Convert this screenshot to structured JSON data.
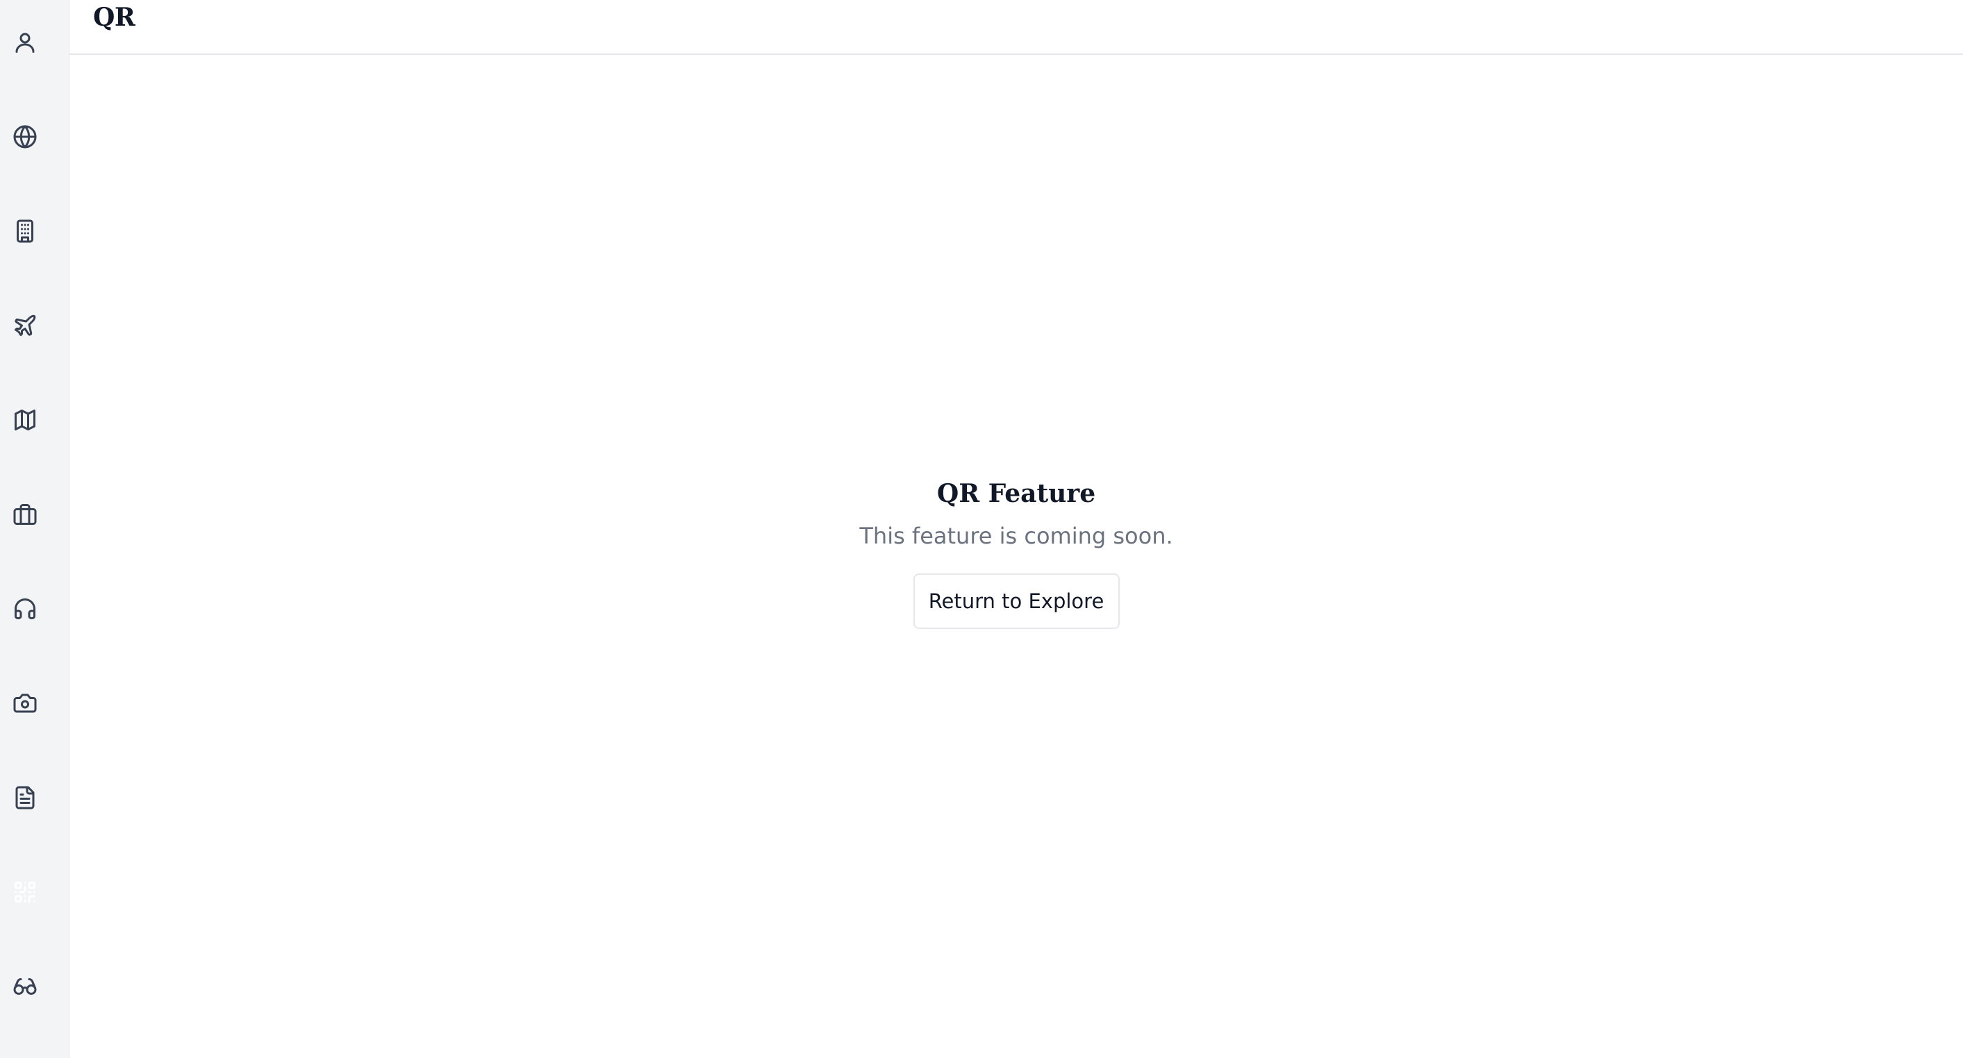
{
  "header": {
    "title": "QR"
  },
  "sidebar": {
    "items": [
      {
        "icon": "user-icon",
        "label": "Profile"
      },
      {
        "icon": "globe-icon",
        "label": "Explore"
      },
      {
        "icon": "building-icon",
        "label": "Hotels"
      },
      {
        "icon": "plane-icon",
        "label": "Flights"
      },
      {
        "icon": "map-icon",
        "label": "Maps"
      },
      {
        "icon": "briefcase-icon",
        "label": "Trips"
      },
      {
        "icon": "headphones-icon",
        "label": "Support"
      },
      {
        "icon": "camera-icon",
        "label": "Camera"
      },
      {
        "icon": "document-icon",
        "label": "Documents"
      },
      {
        "icon": "qr-code-icon",
        "label": "QR",
        "active": true
      },
      {
        "icon": "glasses-icon",
        "label": "View"
      }
    ]
  },
  "main": {
    "feature_title": "QR Feature",
    "feature_subtitle": "This feature is coming soon.",
    "return_button_label": "Return to Explore"
  },
  "colors": {
    "sidebar_bg": "#f3f4f6",
    "border": "#e5e7eb",
    "text_primary": "#111827",
    "text_muted": "#6b7280",
    "icon": "#374151"
  }
}
